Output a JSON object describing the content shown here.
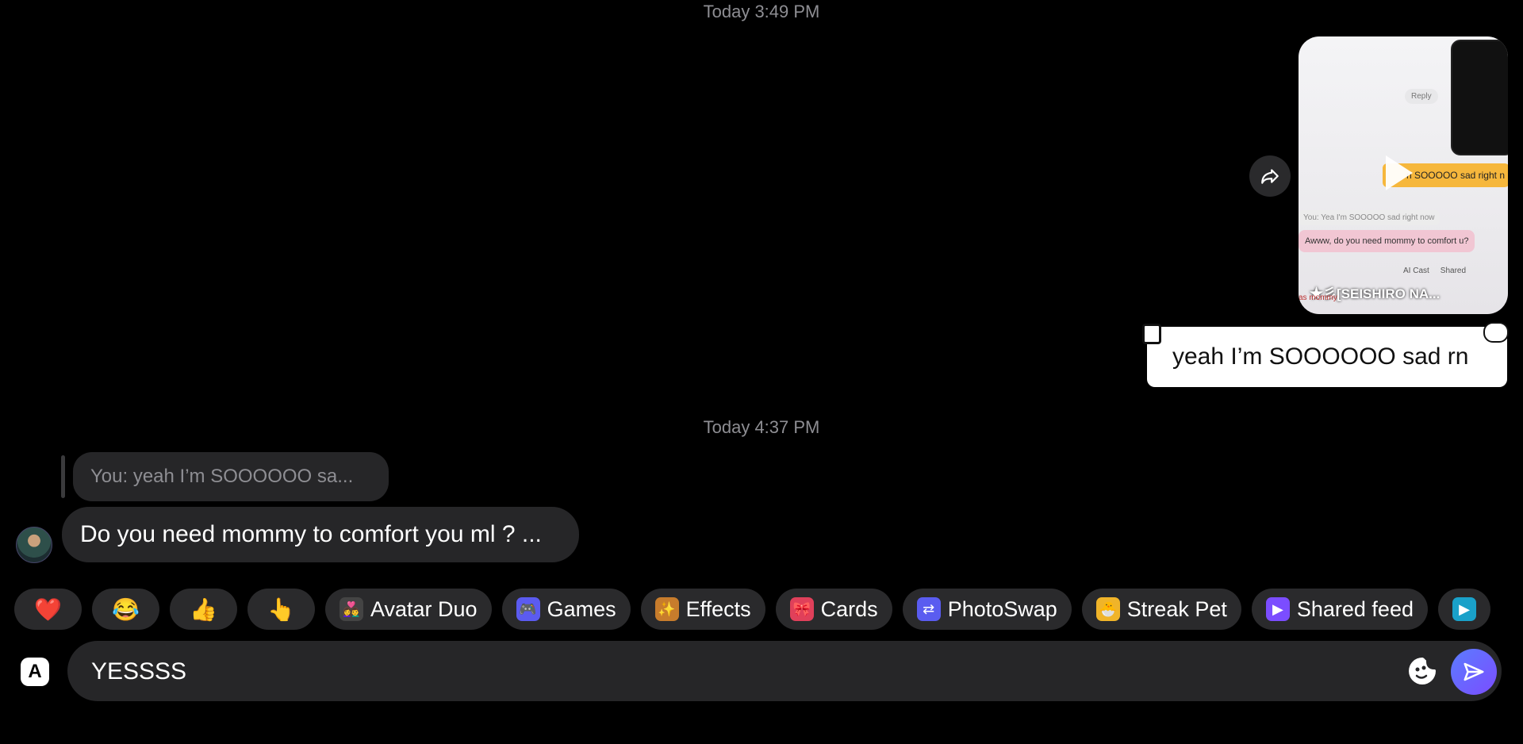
{
  "timestamps": [
    "Today 3:49 PM",
    "Today 4:37 PM"
  ],
  "video_card": {
    "reply_label": "Reply",
    "strip_text": "n SOOOOO sad right n",
    "you_line": "You: Yea I'm SOOOOO sad right now",
    "mommy_line": "Awww, do you need mommy to comfort u?",
    "icon_labels": [
      "AI Cast",
      "Shared"
    ],
    "name": "★彡[SEISHIRO NA...",
    "bottom_text": "as mommy"
  },
  "outgoing_message": "yeah I’m SOOOOOO sad rn",
  "reply_quote": "You: yeah I’m SOOOOOO sa...",
  "incoming_message": "Do you need mommy to comfort you ml ? ...",
  "quick_actions": {
    "emojis": [
      "❤️",
      "😂",
      "👍",
      "👆"
    ],
    "chips": [
      {
        "label": "Avatar Duo",
        "icon": "👩‍❤️‍👨",
        "color": "#444"
      },
      {
        "label": "Games",
        "icon": "🎮",
        "color": "#5b5bf0"
      },
      {
        "label": "Effects",
        "icon": "✨",
        "color": "#c77c2c"
      },
      {
        "label": "Cards",
        "icon": "🎀",
        "color": "#e0405a"
      },
      {
        "label": "PhotoSwap",
        "icon": "⇄",
        "color": "#5a5cf0"
      },
      {
        "label": "Streak Pet",
        "icon": "🐣",
        "color": "#f0b429"
      },
      {
        "label": "Shared feed",
        "icon": "▶",
        "color": "#7b4dff"
      },
      {
        "label": "",
        "icon": "▶",
        "color": "#1aa1c9"
      }
    ]
  },
  "composer": {
    "value": "YESSSS",
    "aa_label": "A"
  }
}
